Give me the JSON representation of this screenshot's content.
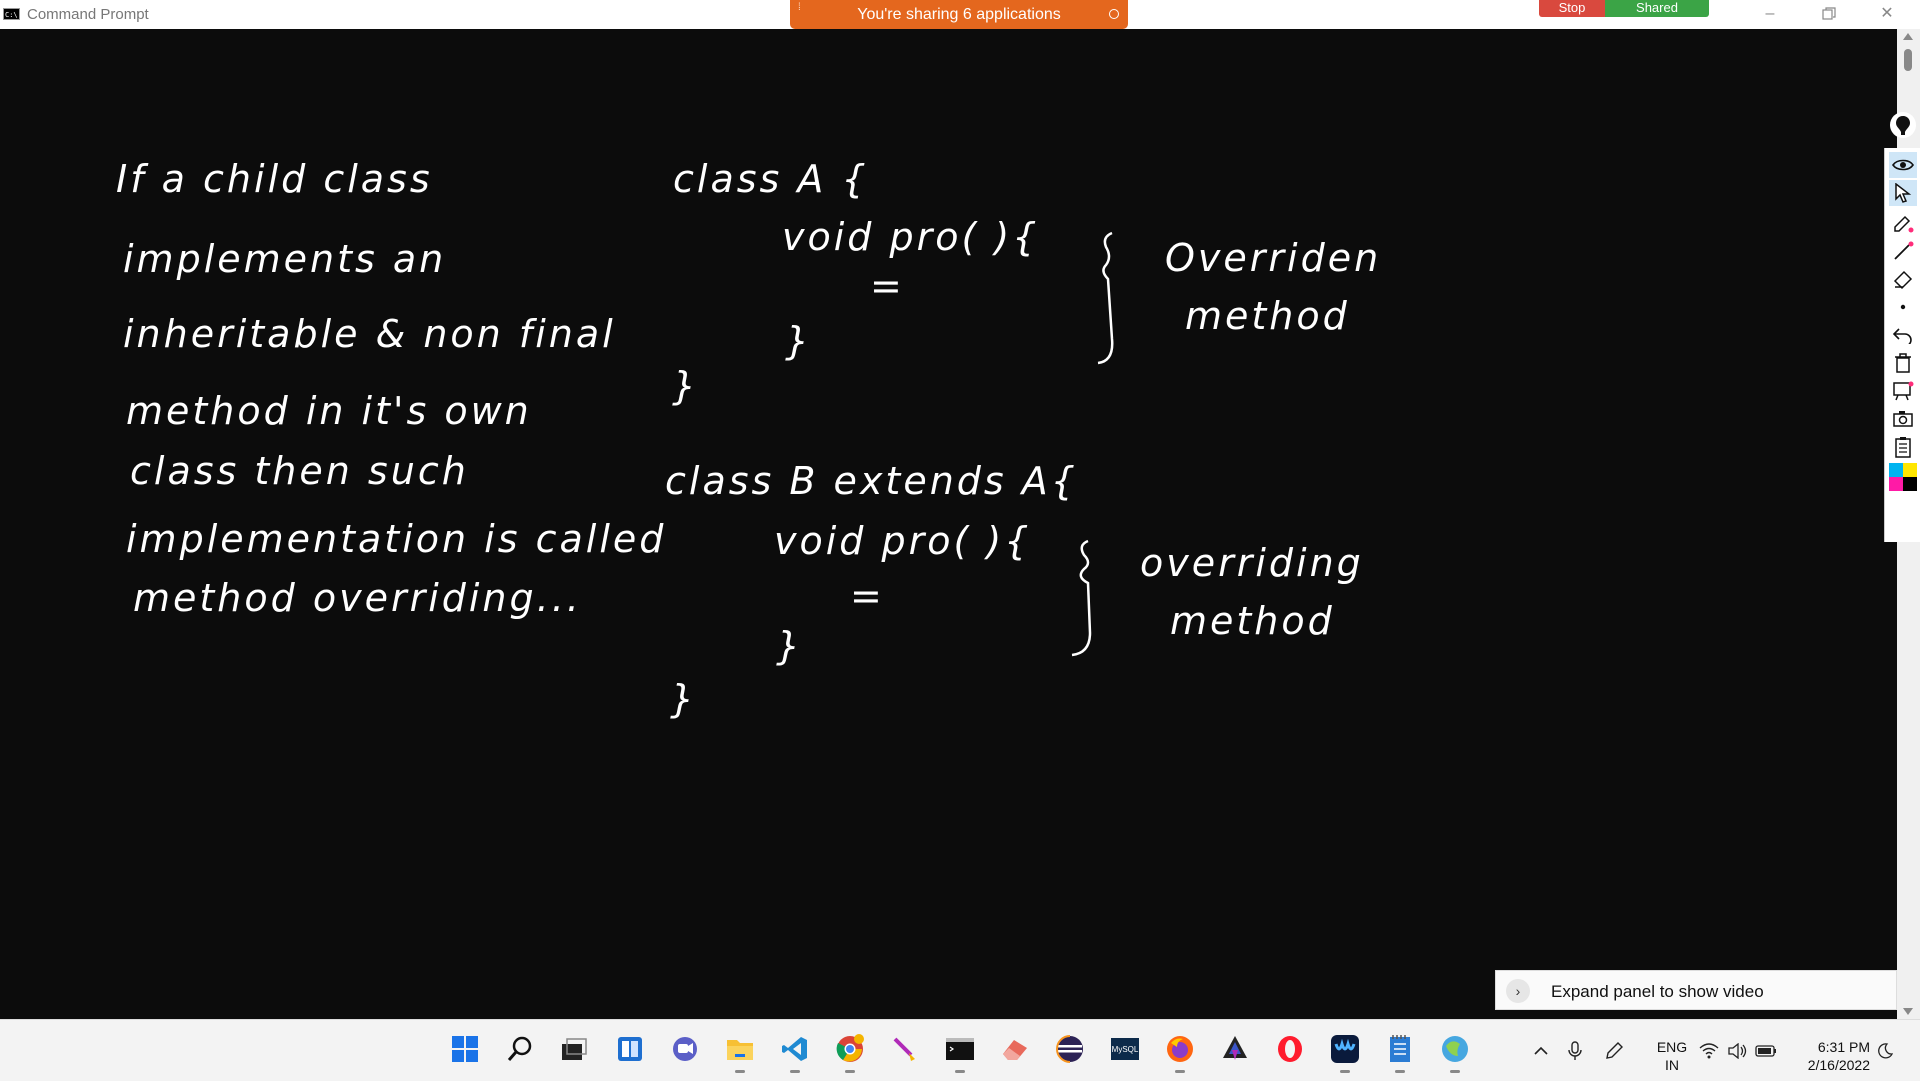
{
  "window": {
    "title": "Command Prompt",
    "icon_text": "C:\\",
    "minimize_icon": "minimize-icon",
    "restore_icon": "restore-icon",
    "close_icon": "close-icon"
  },
  "sharing": {
    "banner_text": "You're sharing 6 applications",
    "stop_label": "Stop",
    "shared_label": "Shared"
  },
  "handwriting": {
    "left_lines": [
      "If a child class",
      "implements an",
      "inheritable & non final",
      "method in it's own",
      "class then such",
      "implementation is called",
      "method overriding..."
    ],
    "code_a": {
      "class_line": "class A {",
      "method_line": "void pro( ){",
      "body_mark": "=",
      "method_close": "}",
      "class_close": "}",
      "annotation": [
        "Overriden",
        "method"
      ]
    },
    "code_b": {
      "class_line": "class B extends A{",
      "method_line": "void pro( ){",
      "body_mark": "=",
      "method_close": "}",
      "class_close": "}",
      "annotation": [
        "overriding",
        "method"
      ]
    }
  },
  "pen_toolbar": {
    "tools": [
      "eye-icon",
      "pointer-icon",
      "pen-icon",
      "line-icon",
      "highlighter-icon",
      "dot-icon",
      "undo-icon",
      "trash-icon",
      "board-icon",
      "camera-icon",
      "clipboard-icon",
      "color-palette-icon"
    ],
    "colors": {
      "cyan": "#00b4f0",
      "yellow": "#ffe600",
      "magenta": "#ff1aa6",
      "black": "#000000"
    }
  },
  "expand_panel": {
    "label": "Expand panel to show video"
  },
  "taskbar": {
    "apps": [
      "windows-start-icon",
      "search-icon",
      "task-view-icon",
      "widgets-icon",
      "teams-chat-icon",
      "file-explorer-icon",
      "vscode-icon",
      "chrome-icon",
      "paint-brush-icon",
      "terminal-icon",
      "eraser-app-icon",
      "eclipse-icon",
      "mysql-icon",
      "firefox-icon",
      "inkscape-icon",
      "opera-icon",
      "webex-icon",
      "notepad-icon",
      "browser-icon"
    ],
    "tray": {
      "chevron": "show-hidden-icons",
      "lang_line1": "ENG",
      "lang_line2": "IN",
      "time": "6:31 PM",
      "date": "2/16/2022"
    }
  },
  "colors": {
    "canvas": "#0c0c0c",
    "ink": "#ffffff",
    "share_banner": "#e4671e",
    "stop": "#d9493e",
    "shared": "#3ba446"
  }
}
